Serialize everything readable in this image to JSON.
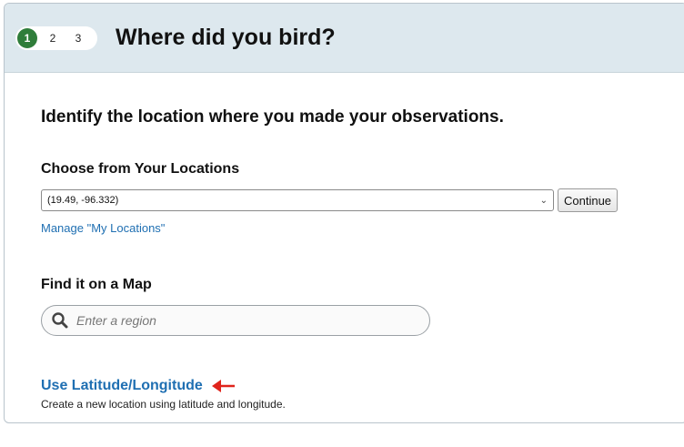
{
  "steps": [
    "1",
    "2",
    "3"
  ],
  "header": {
    "title": "Where did you bird?"
  },
  "instruction": "Identify the location where you made your observations.",
  "locations": {
    "heading": "Choose from Your Locations",
    "selected": "(19.49, -96.332)",
    "continue_label": "Continue",
    "manage_link": "Manage \"My Locations\""
  },
  "map": {
    "heading": "Find it on a Map",
    "search_placeholder": "Enter a region"
  },
  "latlong": {
    "link": "Use Latitude/Longitude",
    "description": "Create a new location using latitude and longitude."
  },
  "colors": {
    "header_bg": "#dde8ee",
    "active_step": "#2f7d3a",
    "link": "#1f6fb2",
    "annotation_arrow": "#e0241b"
  },
  "icons": {
    "search": "search-icon",
    "select": "chevron-down-icon",
    "annotation": "arrow-left-icon"
  }
}
